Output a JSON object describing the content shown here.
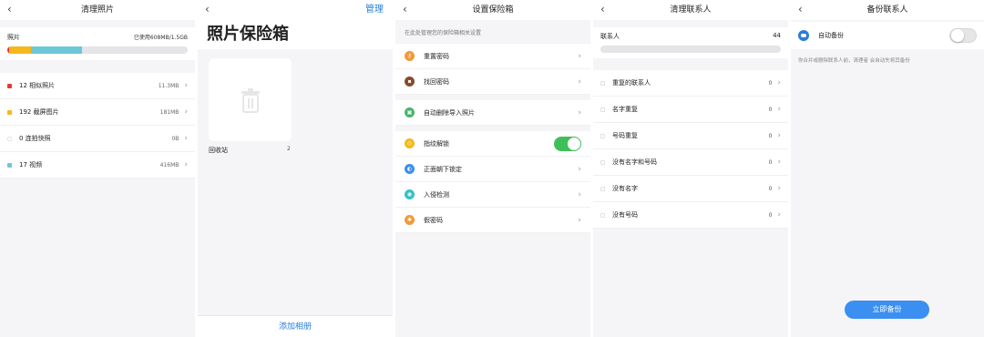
{
  "photo_cleanup": {
    "title": "清理照片",
    "storage_label": "照片",
    "storage_used": "已使用608MB/1.5GB",
    "storage_bar_colors": [
      "#e53935",
      "#f5b81c",
      "#6cc7d6"
    ],
    "items": [
      {
        "label": "12 相似照片",
        "size": "11.3MB",
        "color": "#e53935"
      },
      {
        "label": "192 截屏图片",
        "size": "181MB",
        "color": "#f5b81c"
      },
      {
        "label": "0 连拍快照",
        "size": "0B",
        "color": "#ffffff"
      },
      {
        "label": "17 视频",
        "size": "416MB",
        "color": "#6cc7d6"
      }
    ]
  },
  "vault": {
    "manage": "管理",
    "title": "照片保险箱",
    "album_name": "回收站",
    "album_count": "2",
    "footer": "添加相册"
  },
  "vault_settings": {
    "title": "设置保险箱",
    "hint": "在此处管理您的保险箱相关设置",
    "groups": [
      [
        {
          "label": "重置密码",
          "icon": "key-icon",
          "color": "#f09a3c",
          "control": "chevron"
        },
        {
          "label": "找回密码",
          "icon": "lock-icon",
          "color": "#8a4a2b",
          "control": "chevron"
        }
      ],
      [
        {
          "label": "自动删除导入照片",
          "icon": "delete-auto-icon",
          "color": "#49b36a",
          "control": "chevron"
        }
      ],
      [
        {
          "label": "指纹解锁",
          "icon": "fingerprint-icon",
          "color": "#f5b81c",
          "control": "toggle-on"
        },
        {
          "label": "正面朝下锁定",
          "icon": "face-down-icon",
          "color": "#3a8ff0",
          "control": "chevron"
        },
        {
          "label": "入侵检测",
          "icon": "intrusion-icon",
          "color": "#35c0c9",
          "control": "chevron"
        },
        {
          "label": "假密码",
          "icon": "fake-password-icon",
          "color": "#f09a3c",
          "control": "chevron"
        }
      ]
    ]
  },
  "contacts_cleanup": {
    "title": "清理联系人",
    "label": "联系人",
    "count": "44",
    "items": [
      {
        "label": "重复的联系人",
        "count": "0"
      },
      {
        "label": "名字重复",
        "count": "0"
      },
      {
        "label": "号码重复",
        "count": "0"
      },
      {
        "label": "没有名字和号码",
        "count": "0"
      },
      {
        "label": "没有名字",
        "count": "0"
      },
      {
        "label": "没有号码",
        "count": "0"
      }
    ]
  },
  "contacts_backup": {
    "title": "备份联系人",
    "auto_backup": "自动备份",
    "auto_backup_on": false,
    "desc": "你合并或删除联系人前，清理者 会自动先将其备份",
    "button": "立即备份"
  },
  "symbols": {
    "back": "‹",
    "chevron": "›"
  }
}
